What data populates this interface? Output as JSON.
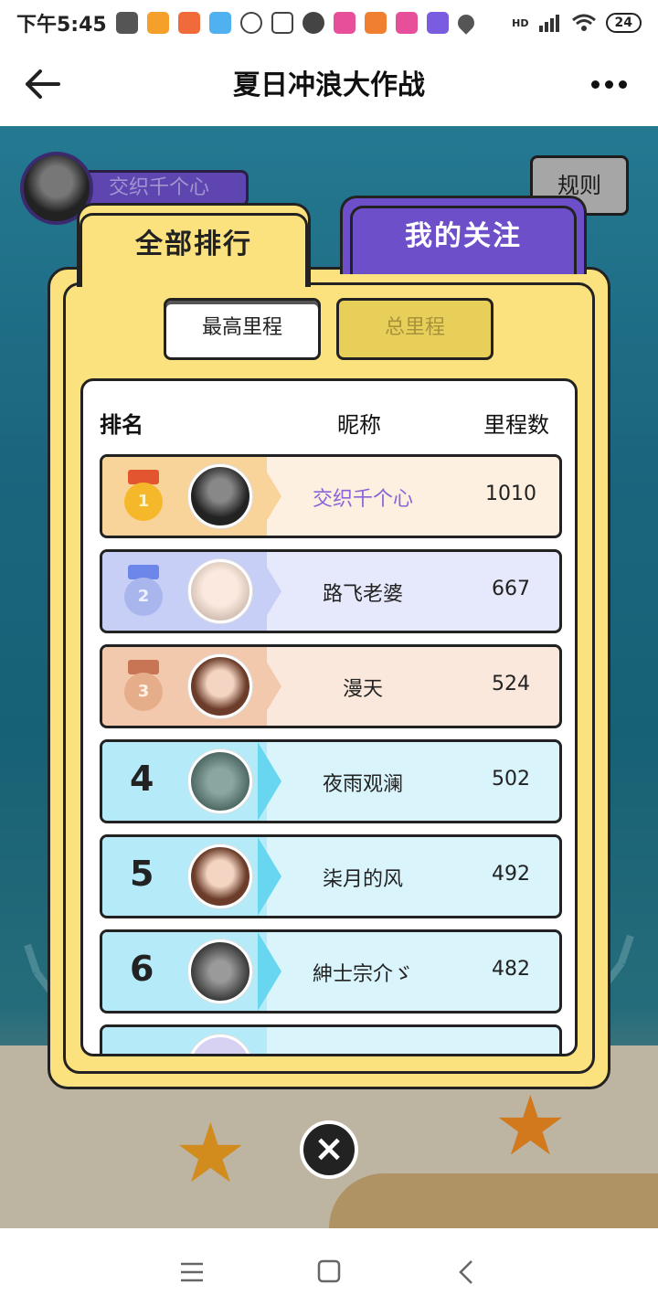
{
  "status_bar": {
    "time": "下午5:45",
    "battery": "24",
    "network": "HD"
  },
  "app_bar": {
    "title": "夏日冲浪大作战"
  },
  "game": {
    "current_user_name": "交织千个心",
    "rules_label": "规则"
  },
  "tabs": {
    "all_ranking": "全部排行",
    "my_following": "我的关注"
  },
  "segments": {
    "highest": "最高里程",
    "total": "总里程"
  },
  "table_header": {
    "rank": "排名",
    "nickname": "昵称",
    "distance": "里程数"
  },
  "ranking": [
    {
      "rank": "1",
      "name": "交织千个心",
      "value": "1010",
      "highlight": true
    },
    {
      "rank": "2",
      "name": "路飞老婆",
      "value": "667"
    },
    {
      "rank": "3",
      "name": "漫天",
      "value": "524"
    },
    {
      "rank": "4",
      "name": "夜雨观澜",
      "value": "502"
    },
    {
      "rank": "5",
      "name": "柒月的风",
      "value": "492"
    },
    {
      "rank": "6",
      "name": "紳士宗介ゞ",
      "value": "482"
    }
  ],
  "colors": {
    "gold": "#f5b82a",
    "silver": "#8ea2ec",
    "bronze": "#dc9a70",
    "other": "#67d6ee",
    "tab_active": "#fbe27f",
    "tab_inactive": "#6d4fc9",
    "highlight_name": "#8a64d8"
  },
  "icons": {
    "back": "back-arrow-icon",
    "more": "more-dots-icon",
    "close": "close-icon"
  }
}
